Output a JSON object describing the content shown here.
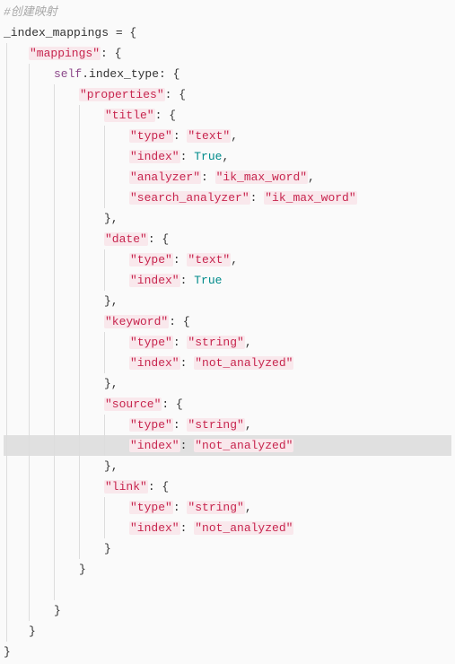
{
  "comment": "#创建映射",
  "var_name": "_index_mappings",
  "mappings_key": "\"mappings\"",
  "self": "self",
  "index_type": ".index_type:",
  "properties_key": "\"properties\"",
  "fields": {
    "title": {
      "name": "\"title\"",
      "type_k": "\"type\"",
      "type_v": "\"text\"",
      "index_k": "\"index\"",
      "index_v": "True",
      "analyzer_k": "\"analyzer\"",
      "analyzer_v": "\"ik_max_word\"",
      "search_k": "\"search_analyzer\"",
      "search_v": "\"ik_max_word\""
    },
    "date": {
      "name": "\"date\"",
      "type_k": "\"type\"",
      "type_v": "\"text\"",
      "index_k": "\"index\"",
      "index_v": "True"
    },
    "keyword": {
      "name": "\"keyword\"",
      "type_k": "\"type\"",
      "type_v": "\"string\"",
      "index_k": "\"index\"",
      "index_v": "\"not_analyzed\""
    },
    "source": {
      "name": "\"source\"",
      "type_k": "\"type\"",
      "type_v": "\"string\"",
      "index_k": "\"index\"",
      "index_v": "\"not_analyzed\""
    },
    "link": {
      "name": "\"link\"",
      "type_k": "\"type\"",
      "type_v": "\"string\"",
      "index_k": "\"index\"",
      "index_v": "\"not_analyzed\""
    }
  },
  "sym": {
    "eq_open": " = {",
    "colon_open": ": {",
    "comma": ",",
    "close": "}",
    "colon": ": ",
    "close_comma": "},"
  }
}
